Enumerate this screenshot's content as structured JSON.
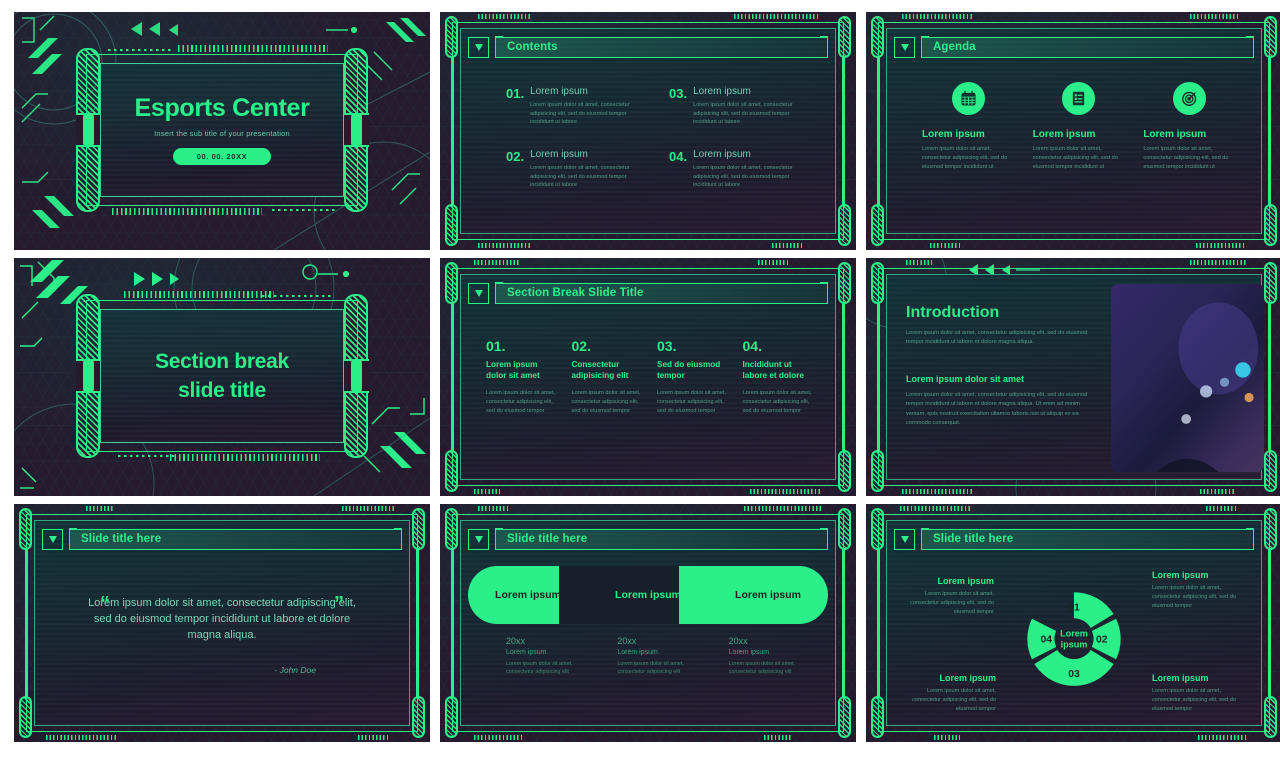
{
  "theme": {
    "accent": "#2bf08a",
    "bg": "#251a2e",
    "panel_top": "#133038",
    "text_dim": "#4e9c86"
  },
  "slides": [
    {
      "id": "title-slide",
      "type": "title",
      "title": "Esports Center",
      "subtitle": "Insert the sub title of your presentation",
      "date": "00. 00. 20XX"
    },
    {
      "id": "contents-slide",
      "type": "contents",
      "header": "Contents",
      "items": [
        {
          "num": "01.",
          "head": "Lorem ipsum",
          "desc": "Lorem ipsum dolor sit amet, consectetur adipisicing elit, sed do eiusmod tempor incididunt ut labore"
        },
        {
          "num": "03.",
          "head": "Lorem ipsum",
          "desc": "Lorem ipsum dolor sit amet, consectetur adipisicing elit, sed do eiusmod tempor incididunt ut labore"
        },
        {
          "num": "02.",
          "head": "Lorem ipsum",
          "desc": "Lorem ipsum dolor sit amet, consectetur adipisicing elit, sed do eiusmod tempor incididunt ut labore"
        },
        {
          "num": "04.",
          "head": "Lorem ipsum",
          "desc": "Lorem ipsum dolor sit amet, consectetur adipisicing elit, sed do eiusmod tempor incididunt ut labore"
        }
      ]
    },
    {
      "id": "agenda-slide",
      "type": "agenda",
      "header": "Agenda",
      "items": [
        {
          "icon": "calendar-icon",
          "title": "Lorem ipsum",
          "desc": "Lorem ipsum dolor sit amet, consectetur adipisicing elit, sed do eiusmod tempor incididunt ut"
        },
        {
          "icon": "checklist-icon",
          "title": "Lorem ipsum",
          "desc": "Lorem ipsum dolor sit amet, consectetur adipisicing elit, sed do eiusmod tempor incididunt ut"
        },
        {
          "icon": "target-icon",
          "title": "Lorem ipsum",
          "desc": "Lorem ipsum dolor sit amet, consectetur adipisicing elit, sed do eiusmod tempor incididunt ut"
        }
      ]
    },
    {
      "id": "section-break-slide",
      "type": "title",
      "title_line1": "Section break",
      "title_line2": "slide title"
    },
    {
      "id": "section-break-columns-slide",
      "type": "four-column",
      "header": "Section Break Slide Title",
      "items": [
        {
          "num": "01.",
          "head": "Lorem ipsum dolor sit amet",
          "desc": "Lorem ipsum dolor sit amet, consectetur adipisicing elit, sed do eiusmod tempor"
        },
        {
          "num": "02.",
          "head": "Consectetur adipisicing elit",
          "desc": "Lorem ipsum dolor sit amet, consectetur adipisicing elit, sed do eiusmod tempor"
        },
        {
          "num": "03.",
          "head": "Sed do eiusmod tempor",
          "desc": "Lorem ipsum dolor sit amet, consectetur adipisicing elit, sed do eiusmod tempor"
        },
        {
          "num": "04.",
          "head": "Incididunt ut labore et dolore",
          "desc": "Lorem ipsum dolor sit amet, consectetur adipisicing elit, sed do eiusmod tempor"
        }
      ]
    },
    {
      "id": "introduction-slide",
      "type": "introduction",
      "heading": "Introduction",
      "intro_paragraph": "Lorem ipsum dolor sit amet, consectetur adipisicing elit, sed do eiusmod tempor incididunt ut labore et dolore magna aliqua.",
      "subheading": "Lorem ipsum dolor sit amet",
      "body_paragraph": "Lorem ipsum dolor sit amet, consectetur adipisicing elit, sed do eiusmod tempor incididunt ut labore et dolore magna aliqua. Ut enim ad minim veniam, quis nostrud exercitation ullamco laboris nisi ut aliquip ex ea commodo consequat.",
      "image_alt": "gaming-mouse-photo"
    },
    {
      "id": "quote-slide",
      "type": "quote",
      "header": "Slide title here",
      "quote_open": "“",
      "quote_close": "”",
      "quote": "Lorem ipsum dolor sit amet, consectetur adipiscing elit, sed do eiusmod tempor incididunt ut labore et dolore magna aliqua.",
      "author": "- John Doe"
    },
    {
      "id": "timeline-slide",
      "type": "timeline",
      "header": "Slide title here",
      "pills": [
        {
          "label": "Lorem ipsum",
          "active": true
        },
        {
          "label": "Lorem ipsum",
          "active": false
        },
        {
          "label": "Lorem ipsum",
          "active": true
        }
      ],
      "columns": [
        {
          "year": "20xx",
          "title": "Lorem ipsum",
          "desc": "Lorem ipsum dolor sit amet, consectetur adipisicing elit"
        },
        {
          "year": "20xx",
          "title": "Lorem ipsum",
          "desc": "Lorem ipsum dolor sit amet, consectetur adipisicing elit"
        },
        {
          "year": "20xx",
          "title": "Lorem ipsum",
          "desc": "Lorem ipsum dolor sit amet, consectetur adipisicing elit"
        }
      ]
    },
    {
      "id": "donut-slide",
      "type": "donut",
      "header": "Slide title here",
      "center_label_line1": "Lorem",
      "center_label_line2": "ipsum",
      "segments": [
        "01",
        "02",
        "03",
        "04"
      ],
      "labels": [
        {
          "pos": "top-left",
          "head": "Lorem ipsum",
          "desc": "Lorem ipsum dolor sit amet, consectetur adipiscing elit, sed do eiusmod tempor"
        },
        {
          "pos": "top-right",
          "head": "Lorem ipsum",
          "desc": "Lorem ipsum dolor sit amet, consectetur adipiscing elit, sed do eiusmod tempor"
        },
        {
          "pos": "bottom-left",
          "head": "Lorem ipsum",
          "desc": "Lorem ipsum dolor sit amet, consectetur adipiscing elit, sed do eiusmod tempor"
        },
        {
          "pos": "bottom-right",
          "head": "Lorem ipsum",
          "desc": "Lorem ipsum dolor sit amet, consectetur adipiscing elit, sed do eiusmod tempor"
        }
      ]
    }
  ]
}
